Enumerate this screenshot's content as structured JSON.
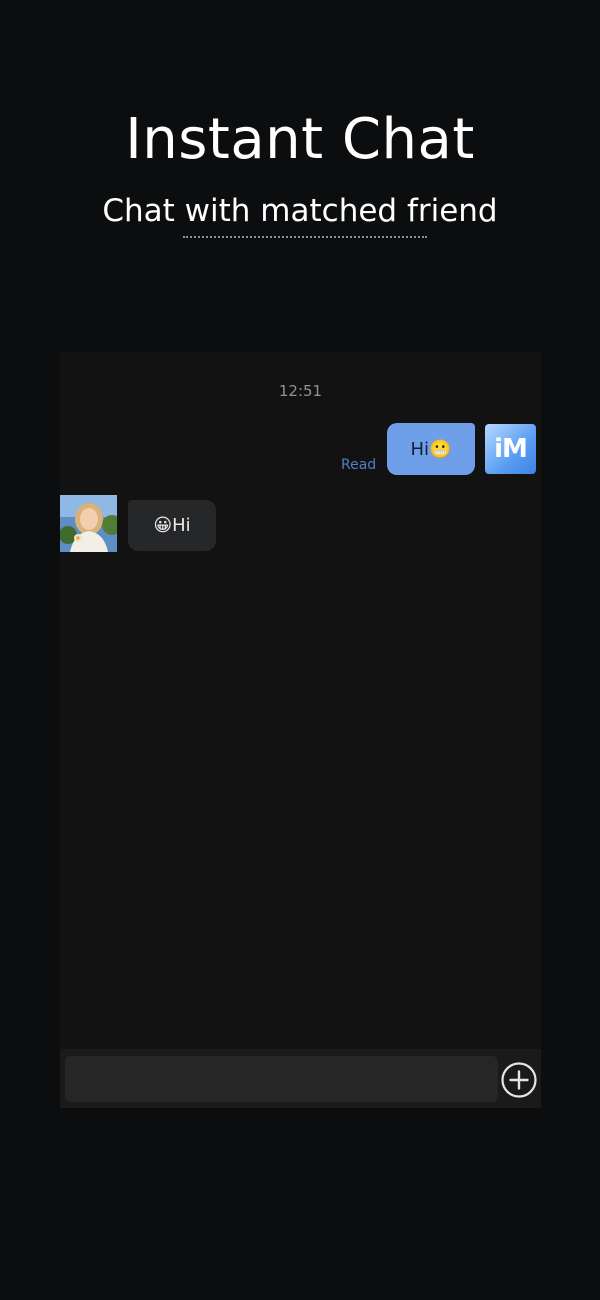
{
  "header": {
    "title": "Instant Chat",
    "subtitle": "Chat with matched friend"
  },
  "chat": {
    "timestamp": "12:51",
    "messages": [
      {
        "sender": "self",
        "text": "Hi😬",
        "status": "Read"
      },
      {
        "sender": "friend",
        "text": "😀Hi"
      }
    ],
    "self_avatar_label": "iM"
  },
  "composer": {
    "input_value": "",
    "add_icon": "plus-circle-icon"
  },
  "colors": {
    "background": "#0c0d0e",
    "panel": "#121212",
    "sent_bubble": "#6e9fe8",
    "received_bubble": "#262729",
    "read_status": "#4f7fc4"
  }
}
